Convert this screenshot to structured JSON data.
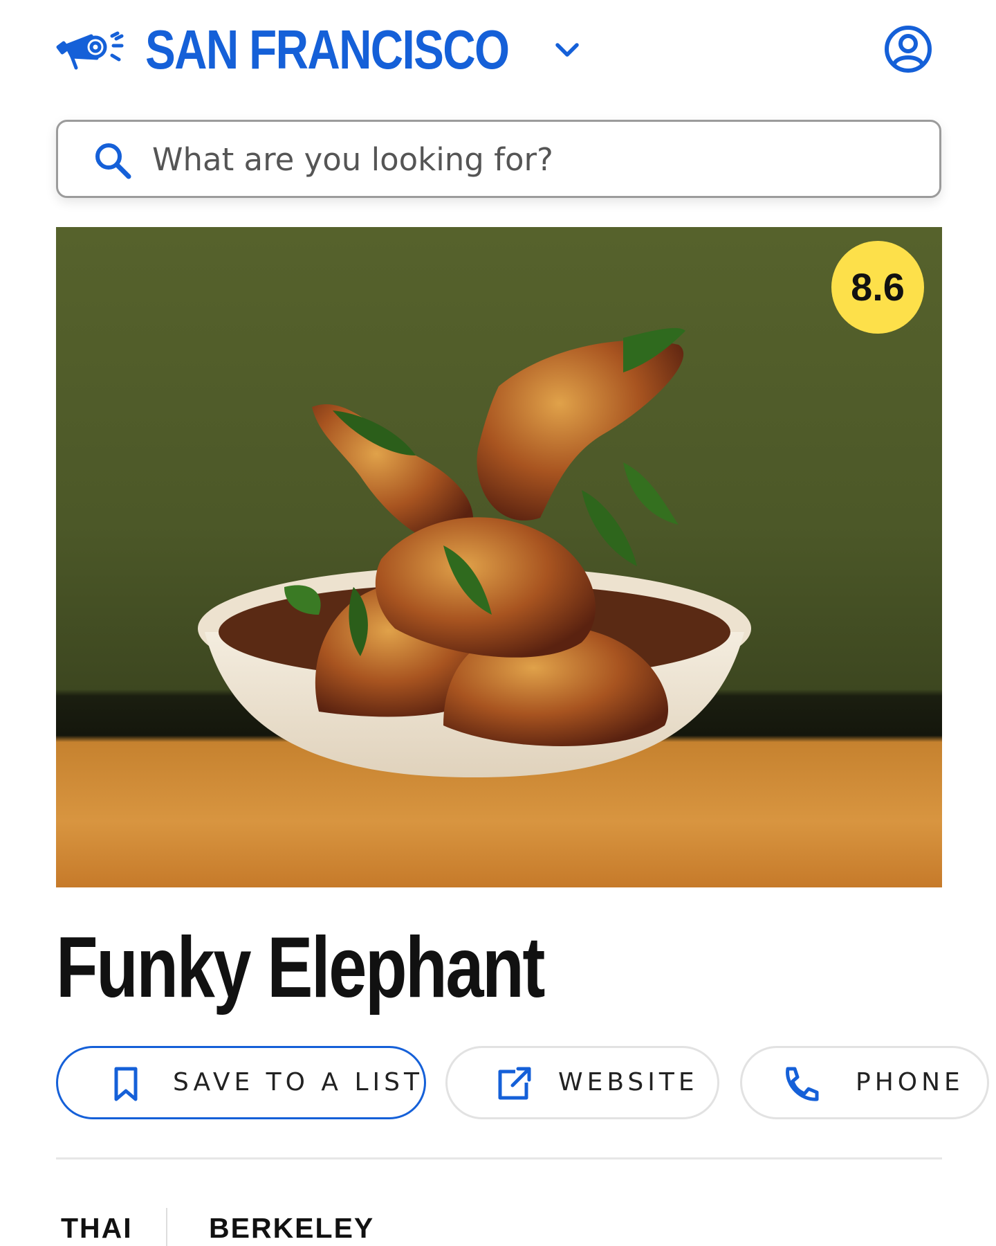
{
  "header": {
    "logo_icon": "megaphone-logo-icon",
    "city": "SAN FRANCISCO",
    "city_dropdown_icon": "chevron-down-icon",
    "account_icon": "user-account-icon"
  },
  "search": {
    "placeholder": "What are you looking for?",
    "icon": "search-icon"
  },
  "restaurant": {
    "name": "Funky Elephant",
    "rating": "8.6",
    "photo_subject": "photo",
    "actions": {
      "save_label": "SAVE TO A LIST",
      "website_label": "WEBSITE",
      "phone_label": "PHONE"
    },
    "tags": [
      "THAI",
      "BERKELEY"
    ]
  },
  "colors": {
    "brand_blue": "#1560d8",
    "rating_yellow": "#fde04a",
    "text": "#111111"
  }
}
